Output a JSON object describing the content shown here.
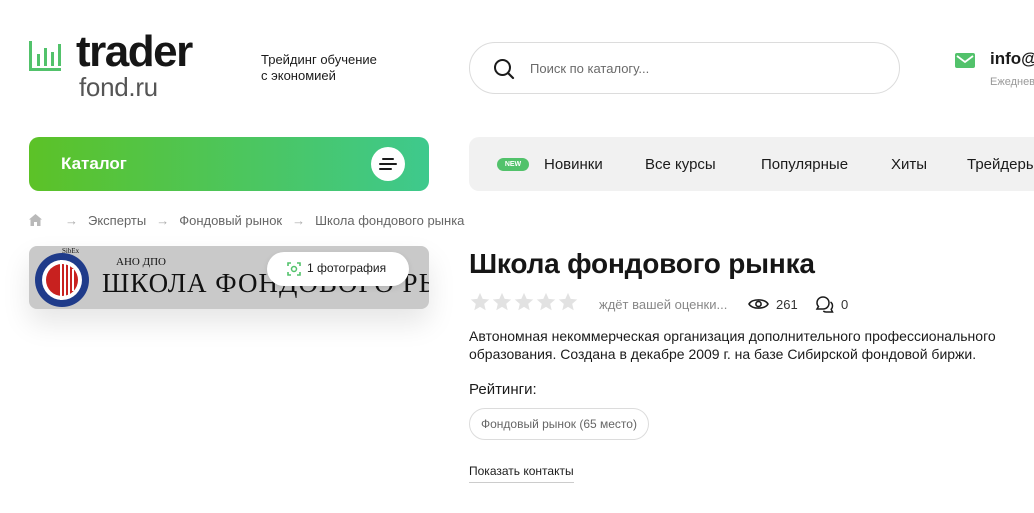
{
  "header": {
    "logo_word": "trader",
    "logo_sub": "fond.ru",
    "tagline_line1": "Трейдинг обучение",
    "tagline_line2": "с экономией",
    "search_placeholder": "Поиск по каталогу...",
    "email": "info@",
    "email_sub": "Ежеднев"
  },
  "catalog": {
    "label": "Каталог"
  },
  "nav": {
    "badge": "NEW",
    "items": [
      "Новинки",
      "Все курсы",
      "Популярные",
      "Хиты",
      "Трейдеры"
    ]
  },
  "breadcrumb": [
    "Эксперты",
    "Фондовый рынок",
    "Школа фондового рынка"
  ],
  "photo": {
    "tiny": "SibEx",
    "small": "АНО ДПО",
    "big": "ШКОЛА ФОНДОВОГО РЫНКА",
    "pill_label": "1 фотография"
  },
  "page": {
    "title": "Школа фондового рынка",
    "rating_note": "ждёт вашей оценки...",
    "rating_stars": 0,
    "views": "261",
    "comments": "0",
    "description": "Автономная некоммерческая организация дополнительного профессионального образования. Создана в декабре 2009 г. на базе Сибирской фондовой биржи.",
    "ratings_heading": "Рейтинги:",
    "rating_chip": "Фондовый рынок (65 место)",
    "contacts_link": "Показать контакты"
  },
  "colors": {
    "brand_green": "#52c26b",
    "catalog_start": "#5cc227",
    "catalog_end": "#3ec98d"
  }
}
